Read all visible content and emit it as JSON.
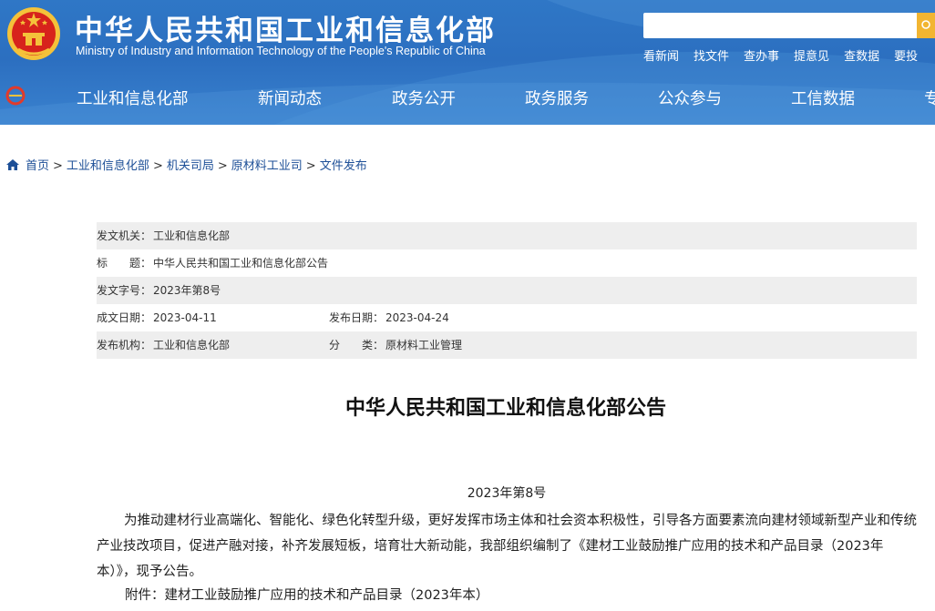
{
  "header": {
    "title": "中华人民共和国工业和信息化部",
    "subtitle": "Ministry of Industry and Information Technology of the People's Republic of China",
    "search_placeholder": "",
    "quick_links": [
      "看新闻",
      "找文件",
      "查办事",
      "提意见",
      "查数据",
      "要投"
    ]
  },
  "nav": {
    "items": [
      "工业和信息化部",
      "新闻动态",
      "政务公开",
      "政务服务",
      "公众参与",
      "工信数据",
      "专"
    ]
  },
  "breadcrumb": {
    "items": [
      "首页",
      "工业和信息化部",
      "机关司局",
      "原材料工业司",
      "文件发布"
    ],
    "separator": ">"
  },
  "meta": {
    "issuer_label": "发文机关：",
    "issuer": "工业和信息化部",
    "title_label": "标　　题：",
    "title": "中华人民共和国工业和信息化部公告",
    "doc_no_label": "发文字号：",
    "doc_no": "2023年第8号",
    "written_label": "成文日期：",
    "written": "2023-04-11",
    "published_label": "发布日期：",
    "published": "2023-04-24",
    "publisher_label": "发布机构：",
    "publisher": "工业和信息化部",
    "category_label": "分　　类：",
    "category": "原材料工业管理"
  },
  "article": {
    "title": "中华人民共和国工业和信息化部公告",
    "doc_no": "2023年第8号",
    "paragraph": "为推动建材行业高端化、智能化、绿色化转型升级，更好发挥市场主体和社会资本积极性，引导各方面要素流向建材领域新型产业和传统产业技改项目，促进产融对接，补齐发展短板，培育壮大新动能，我部组织编制了《建材工业鼓励推广应用的技术和产品目录（2023年本）》，现予公告。",
    "attachment": "附件：建材工业鼓励推广应用的技术和产品目录（2023年本）"
  },
  "colors": {
    "header_blue": "#2f77c6",
    "search_button": "#f2b531",
    "link_blue": "#1d4f97",
    "row_shade": "#eeeeee"
  },
  "icons": [
    "national-emblem-icon",
    "search-icon",
    "nav-logo-icon",
    "home-icon"
  ]
}
